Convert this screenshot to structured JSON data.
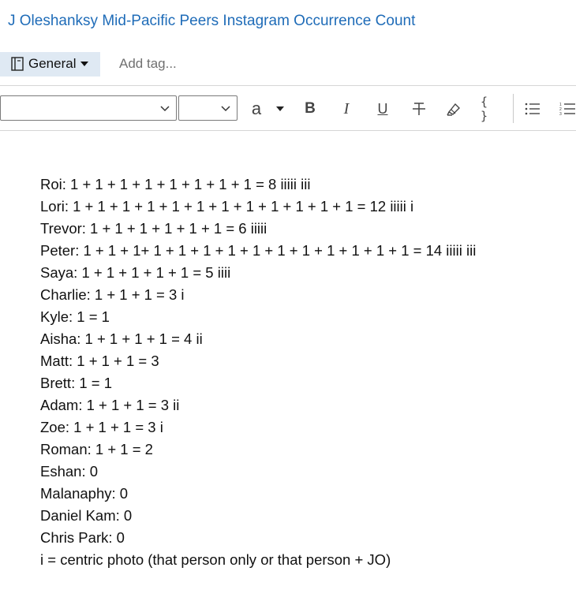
{
  "note": {
    "title": "J Oleshanksy Mid-Pacific Peers Instagram Occurrence Count"
  },
  "tags": {
    "section_label": "General",
    "add_tag_placeholder": "Add tag..."
  },
  "toolbar": {
    "font_family_value": "",
    "font_size_value": "",
    "font_color_letter": "a",
    "icons": [
      "chevron-down-icon",
      "font-color-icon",
      "bold-icon",
      "italic-icon",
      "underline-icon",
      "strikethrough-icon",
      "highlighter-icon",
      "code-icon",
      "bullet-list-icon",
      "numbered-list-icon"
    ],
    "bold_label": "B",
    "italic_label": "I",
    "underline_label": "U",
    "code_label": "{ }"
  },
  "body": {
    "lines": [
      "Roi: 1 + 1 + 1 + 1 + 1 + 1 + 1 + 1 = 8 iiiii iii",
      "Lori: 1 + 1 + 1 + 1 + 1 + 1 + 1 + 1 + 1 + 1 + 1 + 1 = 12 iiiii i",
      "Trevor: 1 + 1 + 1 + 1 + 1 + 1 = 6 iiiii",
      "Peter: 1 + 1 + 1+ 1 + 1 + 1 + 1 + 1 + 1 + 1 + 1 + 1 + 1 + 1 = 14 iiiii iii",
      "Saya: 1 + 1 + 1 + 1 + 1 = 5 iiii",
      "Charlie: 1 + 1 + 1 = 3 i",
      "Kyle: 1 = 1",
      "Aisha: 1 + 1 + 1 + 1 = 4 ii",
      "Matt: 1 + 1 + 1 = 3",
      "Brett: 1 = 1",
      "Adam: 1 + 1 + 1 = 3 ii",
      "Zoe: 1 + 1 + 1 = 3 i",
      "Roman: 1 + 1 = 2",
      "Eshan: 0",
      "Malanaphy: 0",
      "Daniel Kam: 0",
      "Chris Park: 0",
      "i = centric photo (that person only or that person + JO)"
    ]
  },
  "colors": {
    "title": "#1f6cb8",
    "section_bg": "#dfe9f3",
    "placeholder": "#707070",
    "divider": "#d6d6d6"
  }
}
